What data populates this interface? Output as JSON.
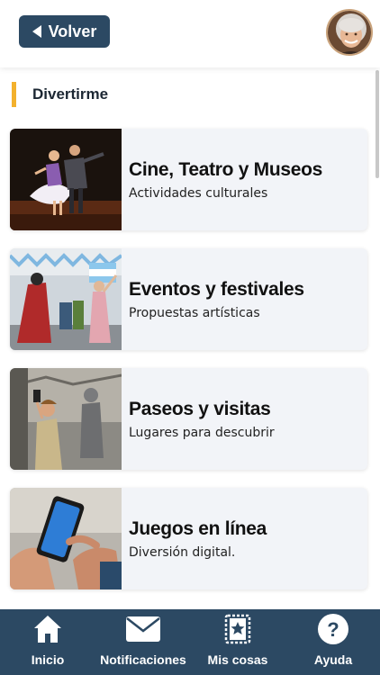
{
  "header": {
    "back_label": "Volver"
  },
  "section": {
    "title": "Divertirme"
  },
  "cards": [
    {
      "title": "Cine, Teatro y Museos",
      "subtitle": "Actividades culturales"
    },
    {
      "title": "Eventos y festivales",
      "subtitle": "Propuestas artísticas"
    },
    {
      "title": "Paseos y visitas",
      "subtitle": "Lugares para descubrir"
    },
    {
      "title": "Juegos en línea",
      "subtitle": "Diversión digital."
    }
  ],
  "nav": [
    {
      "label": "Inicio",
      "icon": "home-icon"
    },
    {
      "label": "Notificaciones",
      "icon": "envelope-icon"
    },
    {
      "label": "Mis cosas",
      "icon": "bookmark-star-icon"
    },
    {
      "label": "Ayuda",
      "icon": "help-icon"
    }
  ],
  "colors": {
    "primary": "#2c4963",
    "accent": "#f3b12d",
    "card_bg": "#f2f4f8"
  }
}
